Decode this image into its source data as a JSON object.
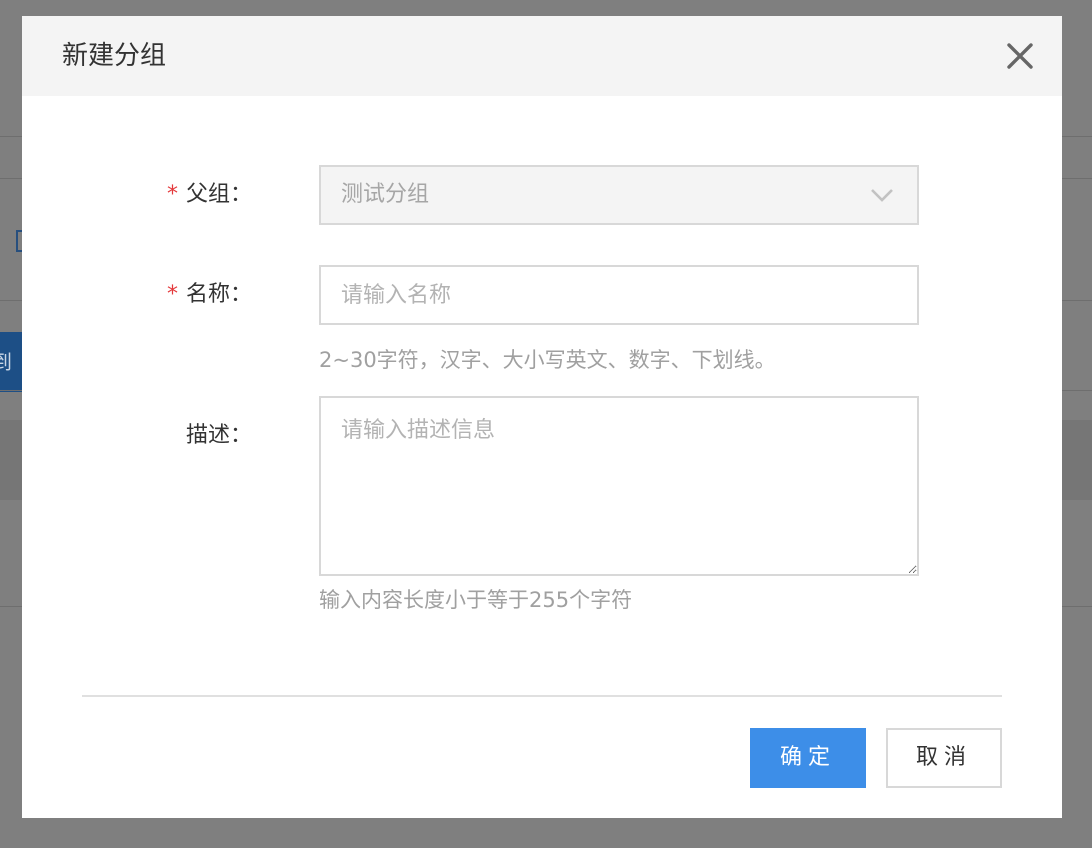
{
  "dialog": {
    "title": "新建分组",
    "close_icon": "close-icon"
  },
  "form": {
    "required_mark": "*",
    "parent_group": {
      "label": "父组：",
      "value": "测试分组",
      "disabled": true,
      "icon": "chevron-down-icon"
    },
    "name": {
      "label": "名称：",
      "placeholder": "请输入名称",
      "value": "",
      "hint": "2~30字符，汉字、大小写英文、数字、下划线。"
    },
    "description": {
      "label": "描述：",
      "placeholder": "请输入描述信息",
      "value": "",
      "hint": "输入内容长度小于等于255个字符"
    }
  },
  "footer": {
    "confirm_label": "确定",
    "cancel_label": "取消"
  },
  "colors": {
    "primary": "#3d8ee8",
    "required": "#e4393c",
    "header_bg": "#f4f4f4",
    "overlay": "#7f7f7f"
  }
}
